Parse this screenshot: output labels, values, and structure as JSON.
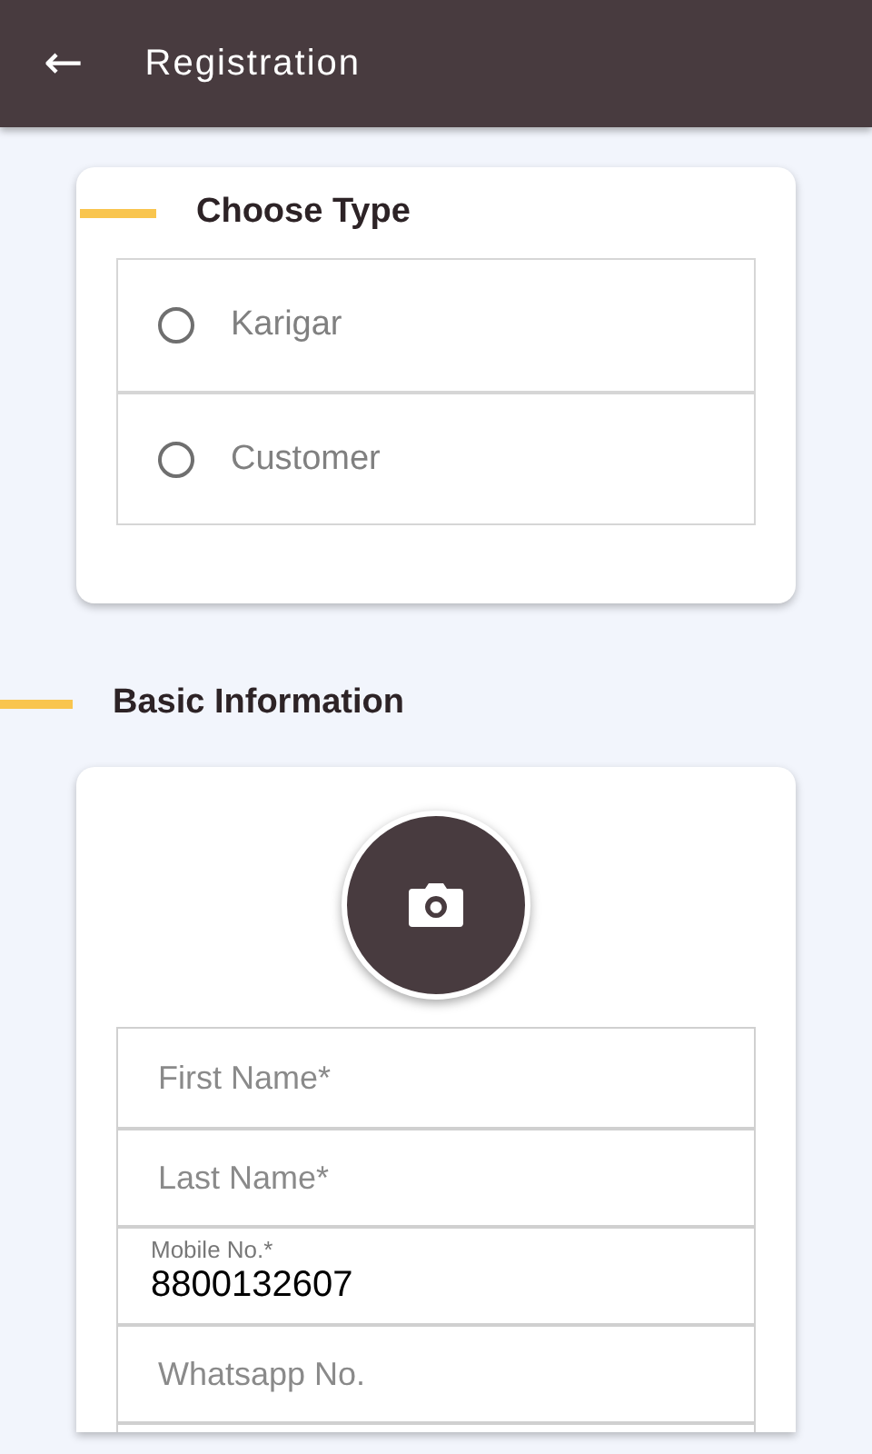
{
  "app_bar": {
    "back_icon": "←",
    "title": "Registration"
  },
  "choose_type": {
    "title": "Choose Type",
    "options": [
      {
        "label": "Karigar",
        "selected": false
      },
      {
        "label": "Customer",
        "selected": false
      }
    ]
  },
  "basic_information": {
    "title": "Basic Information",
    "fields": [
      {
        "kind": "empty",
        "placeholder": "First Name*"
      },
      {
        "kind": "empty",
        "placeholder": "Last Name*"
      },
      {
        "kind": "filled",
        "label": "Mobile No.*",
        "value": "8800132607"
      },
      {
        "kind": "empty",
        "placeholder": "Whatsapp No."
      }
    ]
  }
}
